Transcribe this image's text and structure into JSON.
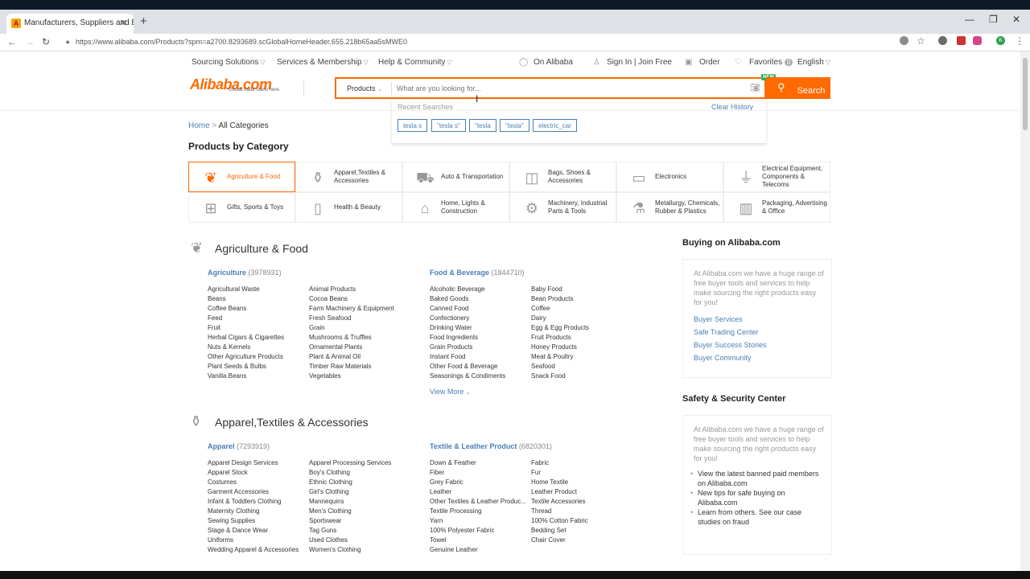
{
  "browser": {
    "tab_title": "Manufacturers, Suppliers and Ex",
    "url": "https://www.alibaba.com/Products?spm=a2700.8293689.scGlobalHomeHeader.655.218b65aa5sMWE0"
  },
  "topnav": {
    "sourcing": "Sourcing Solutions",
    "services": "Services & Membership",
    "help": "Help & Community",
    "on_alibaba": "On Alibaba",
    "signin": "Sign In",
    "join": "Join Free",
    "order": "Order",
    "favorites": "Favorites",
    "favorites_count": "0",
    "language": "English"
  },
  "logo": {
    "name": "Alibaba.com",
    "tagline": "Global trade starts here."
  },
  "search": {
    "category": "Products",
    "placeholder": "What are you looking for...",
    "new_badge": "NEW",
    "button": "Search",
    "recent_label": "Recent Searches",
    "clear_label": "Clear History",
    "recent": [
      "tesla s",
      "\"tesla s\"",
      "\"tesla",
      "\"tesla\"",
      "electric_car"
    ]
  },
  "breadcrumb": {
    "home": "Home",
    "sep": ">",
    "current": "All Categories"
  },
  "products_by_category": "Products by Category",
  "categories": [
    "Agriculture & Food",
    "Apparel,Textiles & Accessories",
    "Auto & Transportation",
    "Bags, Shoes & Accessories",
    "Electronics",
    "Electrical Equipment, Components & Telecoms",
    "Gifts, Sports & Toys",
    "Health & Beauty",
    "Home, Lights & Construction",
    "Machinery, Industrial Parts & Tools",
    "Metallurgy, Chemicals, Rubber & Plastics",
    "Packaging, Advertising & Office"
  ],
  "sections": [
    {
      "title": "Agriculture & Food",
      "groups": [
        {
          "name": "Agriculture",
          "count": "(3978931)",
          "col1": [
            "Agricultural Waste",
            "Beans",
            "Coffee Beans",
            "Feed",
            "Fruit",
            "Herbal Cigars & Cigarettes",
            "Nuts & Kernels",
            "Other Agriculture Products",
            "Plant Seeds & Bulbs",
            "Vanilla Beans"
          ],
          "col2": [
            "Animal Products",
            "Cocoa Beans",
            "Farm Machinery & Equipment",
            "Fresh Seafood",
            "Grain",
            "Mushrooms & Truffles",
            "Ornamental Plants",
            "Plant & Animal Oil",
            "Timber Raw Materials",
            "Vegetables"
          ]
        },
        {
          "name": "Food & Beverage",
          "count": "(1844710)",
          "col1": [
            "Alcoholic Beverage",
            "Baked Goods",
            "Canned Food",
            "Confectionery",
            "Drinking Water",
            "Food Ingredients",
            "Grain Products",
            "Instant Food",
            "Other Food & Beverage",
            "Seasonings & Condiments"
          ],
          "col2": [
            "Baby Food",
            "Bean Products",
            "Coffee",
            "Dairy",
            "Egg & Egg Products",
            "Fruit Products",
            "Honey Products",
            "Meat & Poultry",
            "Seafood",
            "Snack Food"
          ]
        }
      ],
      "view_more": "View More"
    },
    {
      "title": "Apparel,Textiles & Accessories",
      "groups": [
        {
          "name": "Apparel",
          "count": "(7293919)",
          "col1": [
            "Apparel Design Services",
            "Apparel Stock",
            "Costumes",
            "Garment Accessories",
            "Infant & Toddlers Clothing",
            "Maternity Clothing",
            "Sewing Supplies",
            "Stage & Dance Wear",
            "Uniforms",
            "Wedding Apparel & Accessories"
          ],
          "col2": [
            "Apparel Processing Services",
            "Boy's Clothing",
            "Ethnic Clothing",
            "Girl's Clothing",
            "Mannequins",
            "Men's Clothing",
            "Sportswear",
            "Tag Guns",
            "Used Clothes",
            "Women's Clothing"
          ]
        },
        {
          "name": "Textile & Leather Product",
          "count": "(6820301)",
          "col1": [
            "Down & Feather",
            "Fiber",
            "Grey Fabric",
            "Leather",
            "Other Textiles & Leather Produc...",
            "Textile Processing",
            "Yarn",
            "100% Polyester Fabric",
            "Towel",
            "Genuine Leather"
          ],
          "col2": [
            "Fabric",
            "Fur",
            "Home Textile",
            "Leather Product",
            "Textile Accessories",
            "Thread",
            "100% Cotton Fabric",
            "Bedding Set",
            "Chair Cover"
          ]
        }
      ]
    }
  ],
  "sidebar": {
    "buying": {
      "title": "Buying on Alibaba.com",
      "desc": "At Alibaba.com we have a huge range of free buyer tools and services to help make sourcing the right products easy for you!",
      "links": [
        "Buyer Services",
        "Safe Trading Center",
        "Buyer Success Stories",
        "Buyer Community"
      ]
    },
    "safety": {
      "title": "Safety & Security Center",
      "desc": "At Alibaba.com we have a huge range of free buyer tools and services to help make sourcing the right products easy for you!",
      "bullets": [
        "View the latest banned paid members on Alibaba.com",
        "New tips for safe buying on Alibaba.com",
        "Learn from others. See our case studies on fraud"
      ]
    }
  },
  "colors": {
    "accent": "#ff6a00",
    "link": "#4a7fb5"
  }
}
